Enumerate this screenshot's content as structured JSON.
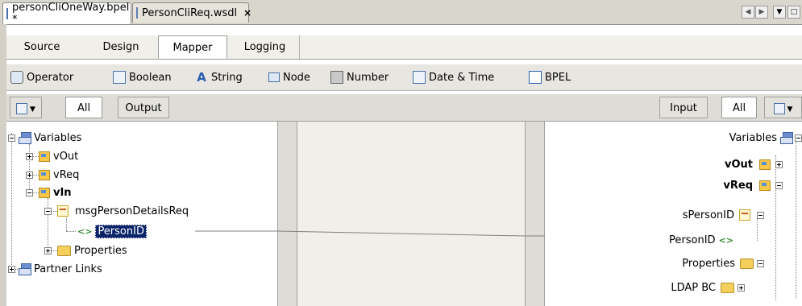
{
  "file_tabs": [
    {
      "label": "personCliOneWay.bpel *",
      "close": "×"
    },
    {
      "label": "PersonCliReq.wsdl",
      "close": "×"
    }
  ],
  "view_tabs": [
    "Source",
    "Design",
    "Mapper",
    "Logging"
  ],
  "palette": [
    "Operator",
    "Boolean",
    "String",
    "Node",
    "Number",
    "Date & Time",
    "BPEL"
  ],
  "left_filter": {
    "all": "All",
    "output": "Output"
  },
  "right_filter": {
    "input": "Input",
    "all": "All"
  },
  "left_tree": {
    "variables": "Variables",
    "vOut": "vOut",
    "vReq": "vReq",
    "vIn": "vIn",
    "msg": "msgPersonDetailsReq",
    "person_id": "PersonID",
    "properties": "Properties",
    "partner_links": "Partner Links"
  },
  "right_tree": {
    "variables": "Variables",
    "vOut": "vOut",
    "vReq": "vReq",
    "s_person_id": "sPersonID",
    "person_id": "PersonID",
    "properties": "Properties",
    "ldap": "LDAP BC"
  }
}
